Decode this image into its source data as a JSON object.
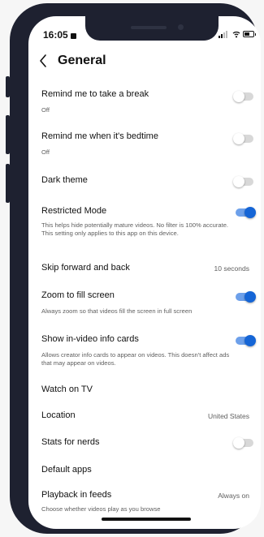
{
  "status_bar": {
    "time": "16:05"
  },
  "header": {
    "back_icon": "chevron-left-icon",
    "title": "General"
  },
  "settings": {
    "remind_break": {
      "label": "Remind me to take a break",
      "description": "Off",
      "enabled": false
    },
    "remind_bedtime": {
      "label": "Remind me when it's bedtime",
      "description": "Off",
      "enabled": false
    },
    "dark_theme": {
      "label": "Dark theme",
      "enabled": false
    },
    "restricted_mode": {
      "label": "Restricted Mode",
      "description": "This helps hide potentially mature videos. No filter is 100% accurate. This setting only applies to this app on this device.",
      "enabled": true
    },
    "skip": {
      "label": "Skip forward and back",
      "value": "10 seconds"
    },
    "zoom": {
      "label": "Zoom to fill screen",
      "description": "Always zoom so that videos fill the screen in full screen",
      "enabled": true
    },
    "info_cards": {
      "label": "Show in-video info cards",
      "description": "Allows creator info cards to appear on videos. This doesn't affect ads that may appear on videos.",
      "enabled": true
    },
    "watch_tv": {
      "label": "Watch on TV"
    },
    "location": {
      "label": "Location",
      "value": "United States"
    },
    "stats": {
      "label": "Stats for nerds",
      "enabled": false
    },
    "default_apps": {
      "label": "Default apps"
    },
    "playback": {
      "label": "Playback in feeds",
      "value": "Always on",
      "description": "Choose whether videos play as you browse"
    }
  },
  "colors": {
    "toggle_on_knob": "#1565d6",
    "toggle_on_track": "#6da0ea",
    "toggle_off_track": "#d8d8d8",
    "frame": "#1e2130"
  }
}
